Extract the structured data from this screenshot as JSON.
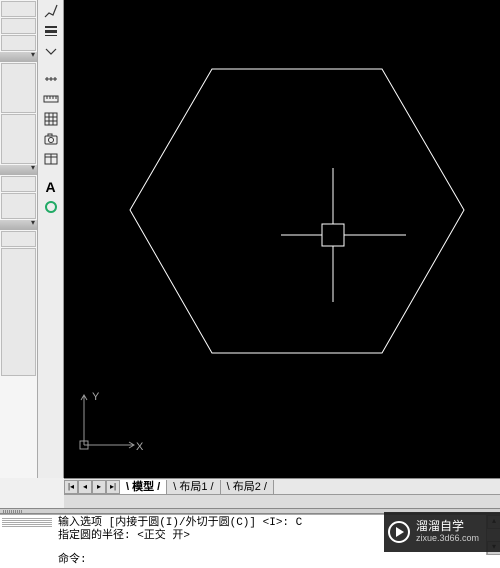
{
  "toolbar_icons": {
    "brush": "brush-icon",
    "lineweight": "lineweight-icon",
    "measure": "measure-icon",
    "ruler": "ruler-icon",
    "grid": "grid-icon",
    "table": "table-icon",
    "camera": "camera-icon",
    "text": "text-icon"
  },
  "tool_text_label": "A",
  "drawing": {
    "ucs": {
      "x_label": "X",
      "y_label": "Y"
    }
  },
  "tabs": {
    "nav_first": "|◂",
    "nav_prev": "◂",
    "nav_next": "▸",
    "nav_last": "▸|",
    "items": [
      {
        "label": "模型",
        "active": true
      },
      {
        "label": "布局1",
        "active": false
      },
      {
        "label": "布局2",
        "active": false
      }
    ]
  },
  "command": {
    "history": [
      "输入选项 [内接于圆(I)/外切于圆(C)] <I>: C",
      "指定圆的半径:  <正交 开>"
    ],
    "prompt": "命令:",
    "input_value": ""
  },
  "watermark": {
    "title": "溜溜自学",
    "url": "zixue.3d66.com"
  }
}
